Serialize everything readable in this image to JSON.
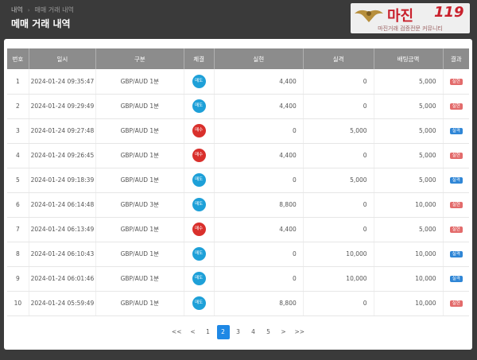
{
  "breadcrumb": {
    "root": "내역",
    "current": "매매 거래 내역"
  },
  "page_title": "메매 거래 내역",
  "logo": {
    "brand": "마진",
    "brand_num": "119",
    "slogan": "마진거래 검증전문 커뮤니티"
  },
  "table": {
    "headers": [
      "번호",
      "일시",
      "구분",
      "체결",
      "실현",
      "실격",
      "배팅금액",
      "결과"
    ],
    "rows": [
      {
        "no": "1",
        "datetime": "2024-01-24 09:35:47",
        "kind": "GBP/AUD 1분",
        "side": "매도",
        "side_type": "sell",
        "realized": "4,400",
        "loss": "0",
        "bet": "5,000",
        "result": "실현",
        "result_type": "fail"
      },
      {
        "no": "2",
        "datetime": "2024-01-24 09:29:49",
        "kind": "GBP/AUD 1분",
        "side": "매도",
        "side_type": "sell",
        "realized": "4,400",
        "loss": "0",
        "bet": "5,000",
        "result": "실현",
        "result_type": "fail"
      },
      {
        "no": "3",
        "datetime": "2024-01-24 09:27:48",
        "kind": "GBP/AUD 1분",
        "side": "매수",
        "side_type": "buy",
        "realized": "0",
        "loss": "5,000",
        "bet": "5,000",
        "result": "실격",
        "result_type": "win"
      },
      {
        "no": "4",
        "datetime": "2024-01-24 09:26:45",
        "kind": "GBP/AUD 1분",
        "side": "매수",
        "side_type": "buy",
        "realized": "4,400",
        "loss": "0",
        "bet": "5,000",
        "result": "실현",
        "result_type": "fail"
      },
      {
        "no": "5",
        "datetime": "2024-01-24 09:18:39",
        "kind": "GBP/AUD 1분",
        "side": "매도",
        "side_type": "sell",
        "realized": "0",
        "loss": "5,000",
        "bet": "5,000",
        "result": "실격",
        "result_type": "win"
      },
      {
        "no": "6",
        "datetime": "2024-01-24 06:14:48",
        "kind": "GBP/AUD 3분",
        "side": "매도",
        "side_type": "sell",
        "realized": "8,800",
        "loss": "0",
        "bet": "10,000",
        "result": "실현",
        "result_type": "fail"
      },
      {
        "no": "7",
        "datetime": "2024-01-24 06:13:49",
        "kind": "GBP/AUD 1분",
        "side": "매수",
        "side_type": "buy",
        "realized": "4,400",
        "loss": "0",
        "bet": "5,000",
        "result": "실현",
        "result_type": "fail"
      },
      {
        "no": "8",
        "datetime": "2024-01-24 06:10:43",
        "kind": "GBP/AUD 1분",
        "side": "매도",
        "side_type": "sell",
        "realized": "0",
        "loss": "10,000",
        "bet": "10,000",
        "result": "실격",
        "result_type": "win"
      },
      {
        "no": "9",
        "datetime": "2024-01-24 06:01:46",
        "kind": "GBP/AUD 1분",
        "side": "매도",
        "side_type": "sell",
        "realized": "0",
        "loss": "10,000",
        "bet": "10,000",
        "result": "실격",
        "result_type": "win"
      },
      {
        "no": "10",
        "datetime": "2024-01-24 05:59:49",
        "kind": "GBP/AUD 1분",
        "side": "매도",
        "side_type": "sell",
        "realized": "8,800",
        "loss": "0",
        "bet": "10,000",
        "result": "실현",
        "result_type": "fail"
      }
    ]
  },
  "pagination": {
    "items": [
      {
        "label": "<<",
        "name": "page-first-button",
        "active": false
      },
      {
        "label": "<",
        "name": "page-prev-button",
        "active": false
      },
      {
        "label": "1",
        "name": "page-1-button",
        "active": false
      },
      {
        "label": "2",
        "name": "page-2-button",
        "active": true
      },
      {
        "label": "3",
        "name": "page-3-button",
        "active": false
      },
      {
        "label": "4",
        "name": "page-4-button",
        "active": false
      },
      {
        "label": "5",
        "name": "page-5-button",
        "active": false
      },
      {
        "label": ">",
        "name": "page-next-button",
        "active": false
      },
      {
        "label": ">>",
        "name": "page-last-button",
        "active": false
      }
    ]
  },
  "colors": {
    "sell": "#1ea0d8",
    "buy": "#d9302c",
    "fail_tag": "#e36b6b",
    "win_tag": "#2f86d6",
    "active_page": "#1e88e5",
    "header_bg": "#8c8c8c",
    "page_bg": "#3a3a3a"
  }
}
